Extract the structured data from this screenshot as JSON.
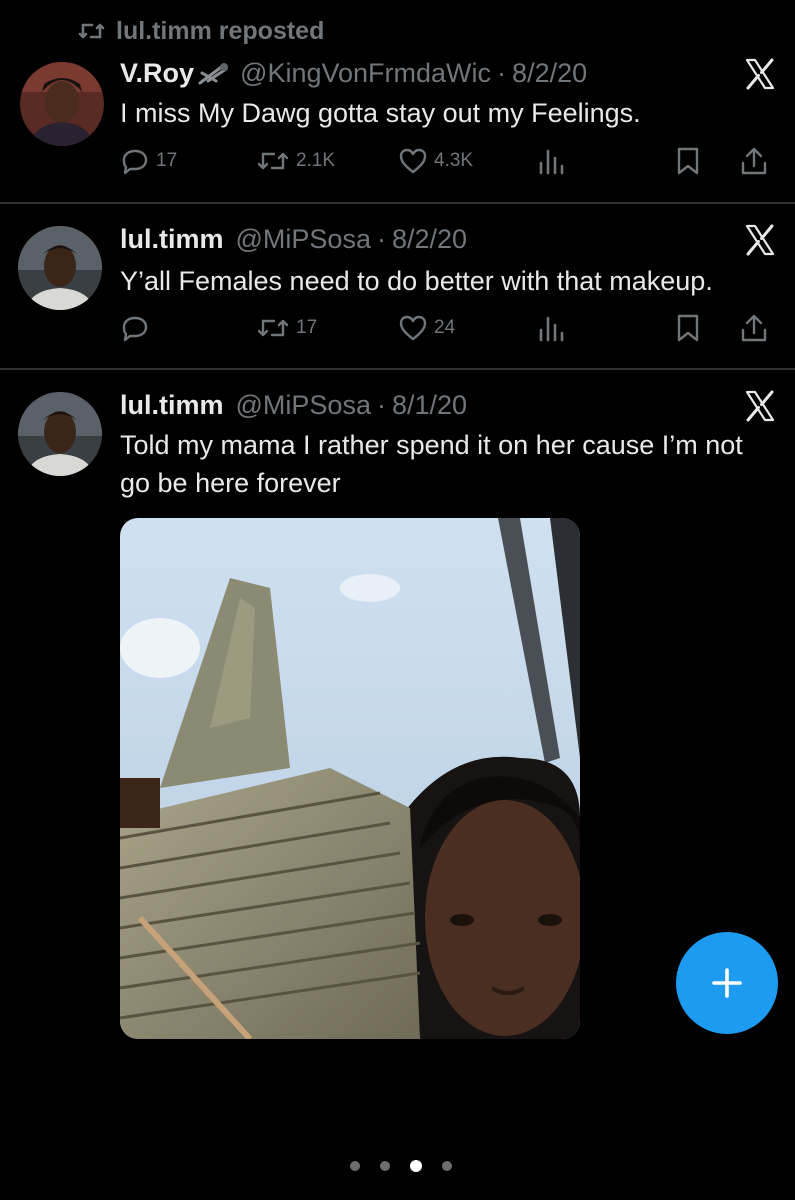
{
  "repost_banner": {
    "text": "lul.timm reposted"
  },
  "tweets": [
    {
      "name": "V.Roy",
      "handle": "@KingVonFrmdaWic",
      "date": "8/2/20",
      "text": "I miss My Dawg gotta stay out my Feelings.",
      "replies": "17",
      "reposts": "2.1K",
      "likes": "4.3K"
    },
    {
      "name": "lul.timm",
      "handle": "@MiPSosa",
      "date": "8/2/20",
      "text": "Y’all Females need to do better with that makeup.",
      "replies": "",
      "reposts": "17",
      "likes": "24"
    },
    {
      "name": "lul.timm",
      "handle": "@MiPSosa",
      "date": "8/1/20",
      "text": "Told my mama I rather spend it on her cause I’m not go be here forever"
    }
  ],
  "separator": "·",
  "icons": {
    "repost_banner": "repost-icon",
    "reply": "reply-icon",
    "repost": "repost-icon",
    "like": "heart-icon",
    "views": "views-icon",
    "bookmark": "bookmark-icon",
    "share": "share-icon",
    "x_logo": "x-logo-icon",
    "compose": "plus-icon"
  },
  "colors": {
    "accent": "#1d9bf0",
    "muted": "#71767b",
    "text": "#e7e9ea",
    "background": "#000000"
  },
  "pager": {
    "count": 4,
    "active_index": 2
  }
}
